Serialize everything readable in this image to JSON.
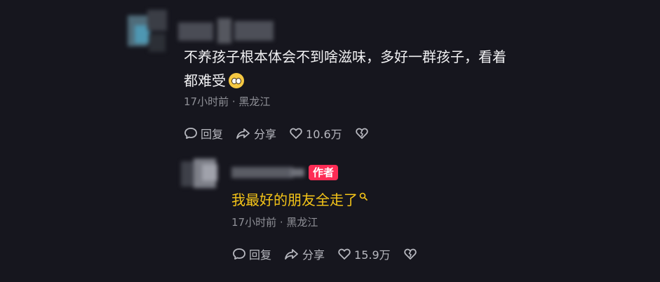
{
  "comment": {
    "text": "不养孩子根本体会不到啥滋味，多好一群孩子，看着都难受",
    "emoji_icon": "pleading-face-icon",
    "meta": "17小时前 · 黑龙江",
    "actions": {
      "reply_label": "回复",
      "share_label": "分享",
      "like_count": "10.6万"
    }
  },
  "reply": {
    "author_badge": "作者",
    "text": "我最好的朋友全走了",
    "meta": "17小时前 · 黑龙江",
    "actions": {
      "reply_label": "回复",
      "share_label": "分享",
      "like_count": "15.9万"
    }
  },
  "colors": {
    "background": "#16161e",
    "badge": "#fe2c55",
    "reply_highlight": "#f5c518"
  }
}
